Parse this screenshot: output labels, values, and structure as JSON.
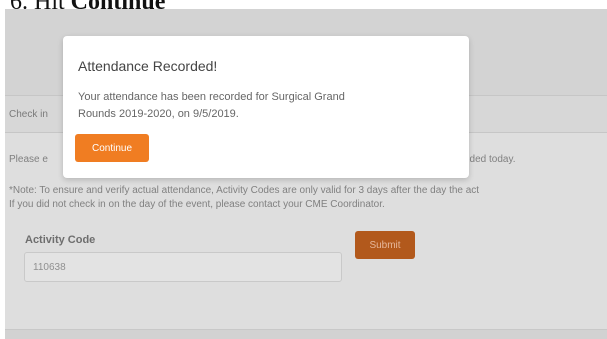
{
  "document": {
    "step_number": "6.",
    "step_instruction_prefix": "Hit",
    "step_instruction_emphasis": "Continue"
  },
  "page": {
    "section_header_partial": "Check in",
    "prompt_partial_left": "Please e",
    "prompt_partial_right": "nded today.",
    "note_line_1": "*Note: To ensure and verify actual attendance, Activity Codes are only valid for 3 days after the day the act",
    "note_line_2": "If you did not check in on the day of the event, please contact your CME Coordinator.",
    "activity_code_label": "Activity Code",
    "activity_code_value": "110638",
    "submit_label": "Submit"
  },
  "modal": {
    "title": "Attendance Recorded!",
    "body_line_1": "Your attendance has been recorded for Surgical Grand",
    "body_line_2": "Rounds 2019-2020, on 9/5/2019.",
    "continue_label": "Continue"
  },
  "colors": {
    "accent_orange": "#f07d22",
    "submit_dimmed": "#b2591c",
    "overlay_gray": "#dcdcdc"
  }
}
